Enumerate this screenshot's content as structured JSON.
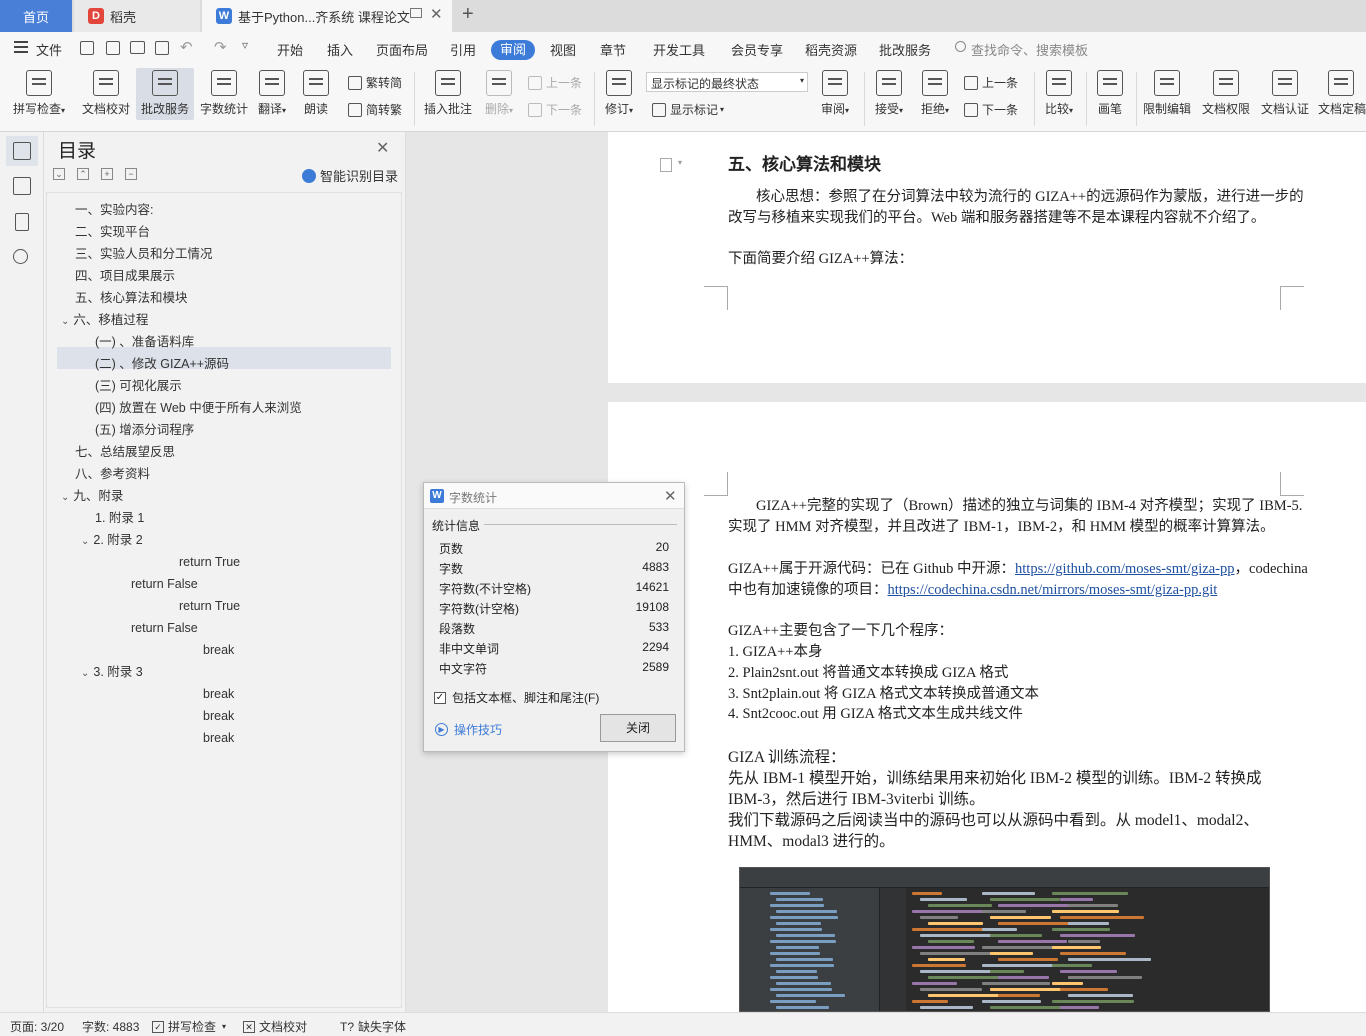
{
  "tabs": {
    "home": "首页",
    "daoke": "稻壳",
    "doc": "基于Python...齐系统 课程论文"
  },
  "menu": {
    "file": "文件",
    "items": [
      "开始",
      "插入",
      "页面布局",
      "引用",
      "审阅",
      "视图",
      "章节",
      "开发工具",
      "会员专享",
      "稻壳资源",
      "批改服务"
    ],
    "active": "审阅",
    "search_placeholder": "查找命令、搜索模板"
  },
  "ribbon": {
    "spell_check": "拼写检查",
    "doc_check": "文档校对",
    "review_service": "批改服务",
    "word_count": "字数统计",
    "translate": "翻译",
    "read_aloud": "朗读",
    "to_simplified": "繁转简",
    "to_traditional": "简转繁",
    "insert_comment": "插入批注",
    "delete": "删除",
    "prev": "上一条",
    "next": "下一条",
    "revise": "修订",
    "markup_select": "显示标记的最终状态",
    "show_markup": "显示标记",
    "review": "审阅",
    "accept": "接受",
    "reject": "拒绝",
    "prev2": "上一条",
    "next2": "下一条",
    "compare": "比较",
    "pen": "画笔",
    "restrict_edit": "限制编辑",
    "doc_permission": "文档权限",
    "doc_cert": "文档认证",
    "doc_final": "文档定稿"
  },
  "toc": {
    "title": "目录",
    "smart": "智能识别目录",
    "items": [
      {
        "label": "一、实验内容:",
        "indent": 0
      },
      {
        "label": "二、实现平台",
        "indent": 0
      },
      {
        "label": "三、实验人员和分工情况",
        "indent": 0
      },
      {
        "label": "四、项目成果展示",
        "indent": 0
      },
      {
        "label": "五、核心算法和模块",
        "indent": 0
      },
      {
        "label": "六、移植过程",
        "indent": 0,
        "expand": "⌄"
      },
      {
        "label": "(一) 、准备语料库",
        "indent": 1
      },
      {
        "label": "(二) 、修改 GIZA++源码",
        "indent": 1
      },
      {
        "label": "(三) 可视化展示",
        "indent": 1
      },
      {
        "label": "(四) 放置在 Web 中便于所有人来浏览",
        "indent": 1
      },
      {
        "label": "(五) 增添分词程序",
        "indent": 1
      },
      {
        "label": "七、总结展望反思",
        "indent": 0
      },
      {
        "label": "八、参考资料",
        "indent": 0
      },
      {
        "label": "九、附录",
        "indent": 0,
        "expand": "⌄"
      },
      {
        "label": "1. 附录 1",
        "indent": 1
      },
      {
        "label": "2. 附录 2",
        "indent": 1,
        "expand": "⌄"
      },
      {
        "label": "return True",
        "indent": 5
      },
      {
        "label": "return False",
        "indent": 3
      },
      {
        "label": "return True",
        "indent": 5
      },
      {
        "label": "return False",
        "indent": 3
      },
      {
        "label": "break",
        "indent": 6
      },
      {
        "label": "3. 附录 3",
        "indent": 1,
        "expand": "⌄"
      },
      {
        "label": "break",
        "indent": 6
      },
      {
        "label": "break",
        "indent": 6
      },
      {
        "label": "break",
        "indent": 6
      }
    ]
  },
  "document": {
    "page1": {
      "heading": "五、核心算法和模块",
      "p1_line1": "核心思想：参照了在分词算法中较为流行的 GIZA++的远源码作为蒙版，进行进一步的",
      "p1_line2": "改写与移植来实现我们的平台。Web 端和服务器搭建等不是本课程内容就不介绍了。",
      "p2": "下面简要介绍 GIZA++算法："
    },
    "page2": {
      "p1_line1": "GIZA++完整的实现了（Brown）描述的独立与词集的 IBM-4 对齐模型；实现了 IBM-5.",
      "p1_line2": "实现了 HMM 对齐模型，并且改进了 IBM-1，IBM-2，和 HMM 模型的概率计算算法。",
      "p2_line1_a": "GIZA++属于开源代码：已在 Github 中开源：",
      "p2_link1": "https://github.com/moses-smt/giza-pp",
      "p2_line1_b": "，codechina",
      "p2_line2_a": "中也有加速镜像的项目：",
      "p2_link2": "https://codechina.csdn.net/mirrors/moses-smt/giza-pp.git",
      "p3": "GIZA++主要包含了一下几个程序：",
      "list": [
        "1.    GIZA++本身",
        "2.    Plain2snt.out  将普通文本转换成 GIZA 格式",
        "3.    Snt2plain.out 将 GIZA 格式文本转换成普通文本",
        "4.    Snt2cooc.out  用 GIZA 格式文本生成共线文件"
      ],
      "p4_l1": "GIZA 训练流程：",
      "p4_l2": "先从 IBM-1 模型开始，训练结果用来初始化 IBM-2 模型的训练。IBM-2 转换成",
      "p4_l3": "IBM-3，然后进行 IBM-3viterbi 训练。",
      "p4_l4": "我们下载源码之后阅读当中的源码也可以从源码中看到。从 model1、modal2、",
      "p4_l5": "HMM、modal3 进行的。"
    }
  },
  "dialog": {
    "title": "字数统计",
    "group": "统计信息",
    "rows": [
      {
        "k": "页数",
        "v": "20"
      },
      {
        "k": "字数",
        "v": "4883"
      },
      {
        "k": "字符数(不计空格)",
        "v": "14621"
      },
      {
        "k": "字符数(计空格)",
        "v": "19108"
      },
      {
        "k": "段落数",
        "v": "533"
      },
      {
        "k": "非中文单词",
        "v": "2294"
      },
      {
        "k": "中文字符",
        "v": "2589"
      }
    ],
    "checkbox": "包括文本框、脚注和尾注(F)",
    "tips": "操作技巧",
    "close": "关闭"
  },
  "status": {
    "page": "页面: 3/20",
    "words": "字数: 4883",
    "spell": "拼写检查",
    "doc_check": "文档校对",
    "missing_font": "缺失字体"
  },
  "colors": {
    "accent": "#3c7bd8",
    "home_tab": "#4a7fd8"
  }
}
